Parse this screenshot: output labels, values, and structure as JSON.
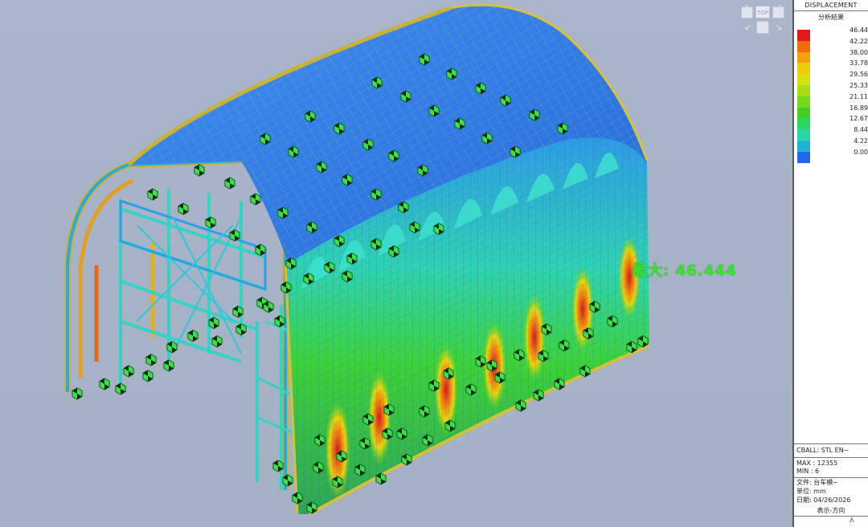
{
  "viewport": {
    "max_label": "最大: 46.444",
    "viewcube_label": "TOP"
  },
  "legend": {
    "title": "DISPLACEMENT",
    "subtitle": "分析結果",
    "values": [
      "46.44",
      "42.22",
      "38.00",
      "33.78",
      "29.56",
      "25.33",
      "21.11",
      "16.89",
      "12.67",
      "8.44",
      "4.22",
      "0.00"
    ],
    "colors": [
      "#e21a1a",
      "#f46a0e",
      "#f6a10c",
      "#f0cb08",
      "#d6e10e",
      "#a6df16",
      "#72d91c",
      "#41cf26",
      "#2ad65e",
      "#27d9a8",
      "#20b0da",
      "#2166ee"
    ]
  },
  "info": {
    "title_line": "CBALL: STL EN~",
    "max_line": "MAX : 12355",
    "min_line": "MIN : 6",
    "file_line": "文件: 台车模~",
    "unit_line": "单位: mm",
    "date_line": "日期: 04/26/2026",
    "display_dir": "表示-方向"
  },
  "colors": {
    "background": "#a6b2c6",
    "mesh_blue": "#2a7ef0",
    "frame_cyan": "#36d0c8",
    "max_label_green": "#39e232"
  }
}
